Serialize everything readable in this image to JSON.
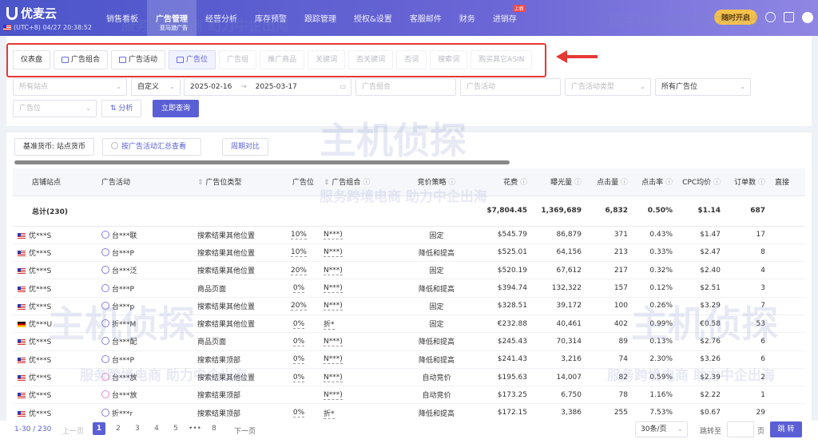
{
  "app": {
    "name": "优麦云",
    "clock": "(UTC+8) 04/27 20:38:52"
  },
  "nav": {
    "items": [
      {
        "label": "销售看板"
      },
      {
        "label": "广告管理",
        "sub": "亚马逊广告"
      },
      {
        "label": "经营分析"
      },
      {
        "label": "库存预警"
      },
      {
        "label": "跟踪管理"
      },
      {
        "label": "授权&设置"
      },
      {
        "label": "客服邮件"
      },
      {
        "label": "财务"
      },
      {
        "label": "进销存",
        "badge": "上新"
      }
    ],
    "cta": "随时开启"
  },
  "tabs": [
    {
      "label": "仪表盘",
      "icon": ""
    },
    {
      "label": "广告组合",
      "icon": "bar-chart-icon"
    },
    {
      "label": "广告活动",
      "icon": "bar-chart-icon"
    },
    {
      "label": "广告位",
      "icon": "bar-chart-icon"
    },
    {
      "label": "广告组"
    },
    {
      "label": "推广商品"
    },
    {
      "label": "关键词"
    },
    {
      "label": "否关键词"
    },
    {
      "label": "否词"
    },
    {
      "label": "搜索词"
    },
    {
      "label": "购买其它ASIN"
    }
  ],
  "active_tab": 3,
  "filters": {
    "site": "所有站点",
    "date_mode": "自定义",
    "start_date": "2025-02-16",
    "date_sep": "→",
    "end_date": "2025-03-17",
    "ad_group_placeholder": "广告组合",
    "campaign_placeholder": "广告活动",
    "campaign_type_placeholder": "广告活动类型",
    "placement": "所有广告位",
    "placement2": "广告位",
    "analyze": "分析",
    "query": "立即查询"
  },
  "toolbar": {
    "currency": "基准货币: 站点货币",
    "by_campaign": "按广告活动汇总查看",
    "compare": "周期对比"
  },
  "table": {
    "headers": [
      "店铺站点",
      "广告活动",
      "广告位类型",
      "广告位",
      "广告组合",
      "竞价策略",
      "花费",
      "曝光量",
      "点击量",
      "点击率",
      "CPC均价",
      "订单数",
      "直接"
    ],
    "total": {
      "label": "总计(230)",
      "spend": "$7,804.45",
      "impressions": "1,369,689",
      "clicks": "6,832",
      "ctr": "0.50%",
      "cpc": "$1.14",
      "orders": "687"
    },
    "rows": [
      {
        "store": "优***S",
        "flag": "us",
        "campaign": "台***联",
        "type": "搜索结果其他位置",
        "placement": "10%",
        "group": "N***)",
        "strategy": "固定",
        "spend": "$545.79",
        "impressions": "86,879",
        "clicks": "371",
        "ctr": "0.43%",
        "cpc": "$1.47",
        "orders": "17"
      },
      {
        "store": "优***S",
        "flag": "us",
        "campaign": "台***P",
        "type": "搜索结果其他位置",
        "placement": "10%",
        "group": "N***)",
        "strategy": "降低和提高",
        "spend": "$525.01",
        "impressions": "64,156",
        "clicks": "213",
        "ctr": "0.33%",
        "cpc": "$2.47",
        "orders": "8"
      },
      {
        "store": "优***S",
        "flag": "us",
        "campaign": "台***泛",
        "type": "搜索结果其他位置",
        "placement": "20%",
        "group": "N***)",
        "strategy": "固定",
        "spend": "$520.19",
        "impressions": "67,612",
        "clicks": "217",
        "ctr": "0.32%",
        "cpc": "$2.40",
        "orders": "4"
      },
      {
        "store": "优***S",
        "flag": "us",
        "campaign": "台***P",
        "type": "商品页面",
        "placement": "0%",
        "group": "N***)",
        "strategy": "降低和提高",
        "spend": "$394.74",
        "impressions": "132,322",
        "clicks": "157",
        "ctr": "0.12%",
        "cpc": "$2.51",
        "orders": "3"
      },
      {
        "store": "优***S",
        "flag": "us",
        "campaign": "台***p",
        "type": "搜索结果其他位置",
        "placement": "20%",
        "group": "N***)",
        "strategy": "固定",
        "spend": "$328.51",
        "impressions": "39,172",
        "clicks": "100",
        "ctr": "0.26%",
        "cpc": "$3.29",
        "orders": "7"
      },
      {
        "store": "优***U",
        "flag": "de",
        "campaign": "折***M",
        "type": "搜索结果其他位置",
        "placement": "0%",
        "group": "折*",
        "strategy": "固定",
        "spend": "€232.88",
        "impressions": "40,461",
        "clicks": "402",
        "ctr": "0.99%",
        "cpc": "€0.58",
        "orders": "53"
      },
      {
        "store": "优***S",
        "flag": "us",
        "campaign": "台***配",
        "type": "商品页面",
        "placement": "0%",
        "group": "N***)",
        "strategy": "降低和提高",
        "spend": "$245.43",
        "impressions": "70,314",
        "clicks": "89",
        "ctr": "0.13%",
        "cpc": "$2.76",
        "orders": "6"
      },
      {
        "store": "优***S",
        "flag": "us",
        "campaign": "台***P",
        "type": "搜索结果顶部",
        "placement": "0%",
        "group": "N***)",
        "strategy": "降低和提高",
        "spend": "$241.43",
        "impressions": "3,216",
        "clicks": "74",
        "ctr": "2.30%",
        "cpc": "$3.26",
        "orders": "6"
      },
      {
        "store": "优***S",
        "flag": "us",
        "campaign": "台***放",
        "type": "搜索结果其他位置",
        "placement": "0%",
        "group": "N***)",
        "strategy": "自动竞价",
        "spend": "$195.63",
        "impressions": "14,007",
        "clicks": "82",
        "ctr": "0.59%",
        "cpc": "$2.39",
        "orders": "2"
      },
      {
        "store": "优***S",
        "flag": "us",
        "campaign": "台***放",
        "type": "搜索结果顶部",
        "placement": "",
        "group": "N***)",
        "strategy": "自动竞价",
        "spend": "$173.25",
        "impressions": "6,750",
        "clicks": "78",
        "ctr": "1.16%",
        "cpc": "$2.22",
        "orders": "1"
      },
      {
        "store": "优***S",
        "flag": "us",
        "campaign": "折***r",
        "type": "搜索结果顶部",
        "placement": "0%",
        "group": "折*",
        "strategy": "降低和提高",
        "spend": "$172.15",
        "impressions": "3,386",
        "clicks": "255",
        "ctr": "7.53%",
        "cpc": "$0.67",
        "orders": "29"
      }
    ]
  },
  "pager": {
    "info": "1-30 / 230",
    "prev": "上一页",
    "pages": [
      "1",
      "2",
      "3",
      "4",
      "5",
      "•••",
      "8"
    ],
    "next": "下一页",
    "size": "30条/页",
    "goto": "跳转至",
    "page_label": "页",
    "go": "跳 转"
  },
  "watermark": {
    "cn": "服务跨境电商 助力中企出海",
    "brand": "主机侦探"
  }
}
